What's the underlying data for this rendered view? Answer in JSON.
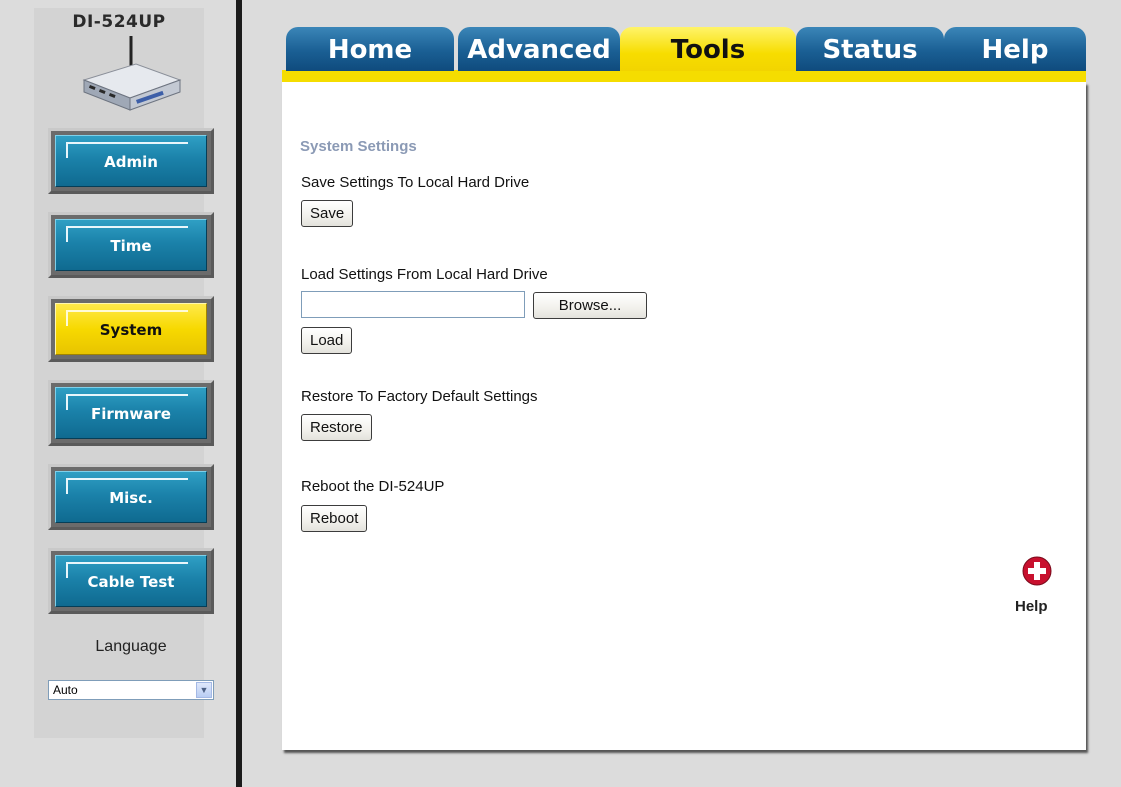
{
  "device": {
    "model": "DI-524UP"
  },
  "sidebar": {
    "items": [
      {
        "label": "Admin"
      },
      {
        "label": "Time"
      },
      {
        "label": "System"
      },
      {
        "label": "Firmware"
      },
      {
        "label": "Misc."
      },
      {
        "label": "Cable Test"
      }
    ],
    "active": "System",
    "language_label": "Language",
    "language_value": "Auto"
  },
  "tabs": {
    "items": [
      {
        "label": "Home"
      },
      {
        "label": "Advanced"
      },
      {
        "label": "Tools"
      },
      {
        "label": "Status"
      },
      {
        "label": "Help"
      }
    ],
    "active": "Tools"
  },
  "main": {
    "section_title": "System Settings",
    "save_label": "Save Settings To Local Hard Drive",
    "save_button": "Save",
    "load_label": "Load Settings From Local Hard Drive",
    "file_value": "",
    "browse_button": "Browse...",
    "load_button": "Load",
    "restore_label": "Restore To Factory Default Settings",
    "restore_button": "Restore",
    "reboot_label": "Reboot the DI-524UP",
    "reboot_button": "Reboot",
    "help_label": "Help"
  },
  "colors": {
    "accent_yellow": "#f7dd00",
    "tab_blue": "#1a5f94",
    "nav_blue": "#1b82aa",
    "section_title": "#8b9ab5"
  }
}
